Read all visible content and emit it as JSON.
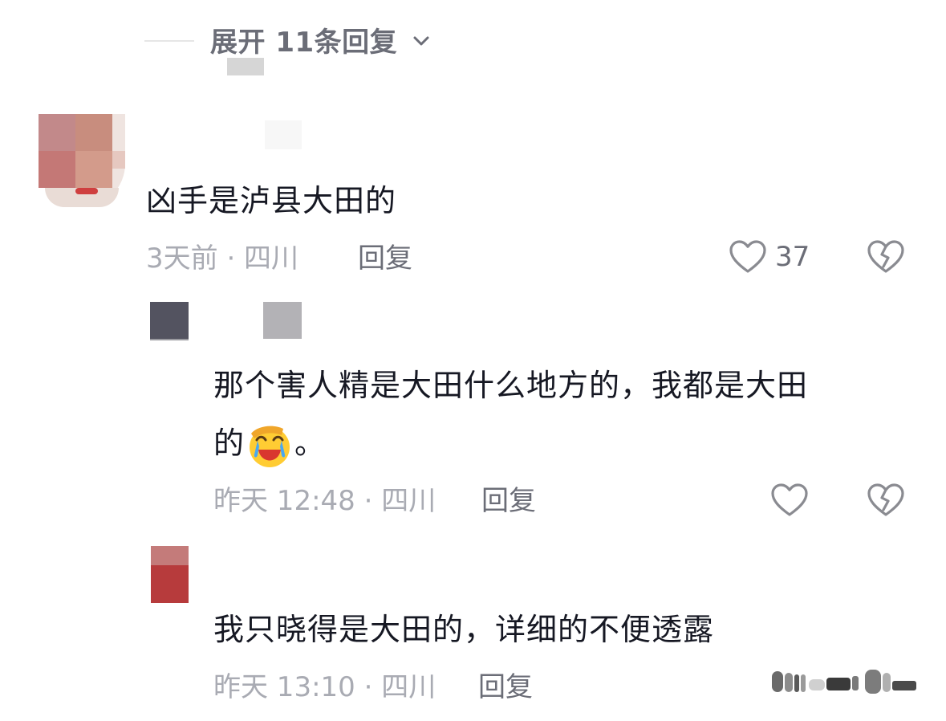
{
  "thread": {
    "expand_replies_label": "展开 11条回复"
  },
  "comments": [
    {
      "text": "凶手是泸县大田的",
      "meta": "3天前 · 四川",
      "reply_label": "回复",
      "like_count": "37"
    },
    {
      "text_line1": "那个害人精是大田什么地方的，我都是大田",
      "text_line2_prefix": "的",
      "text_line2_suffix": "。",
      "meta": "昨天 12:48 · 四川",
      "reply_label": "回复"
    },
    {
      "text": "我只晓得是大田的，详细的不便透露",
      "meta": "昨天 13:10 · 四川",
      "reply_label": "回复"
    }
  ],
  "icons": {
    "expand": "chevron-down-icon",
    "like": "heart-outline-icon",
    "dislike": "broken-heart-icon",
    "emoji": "facepalm-crying-emoji-icon"
  },
  "colors": {
    "primary_text": "#161823",
    "secondary_text": "#6b6d77",
    "meta_text": "#a9abb3"
  }
}
